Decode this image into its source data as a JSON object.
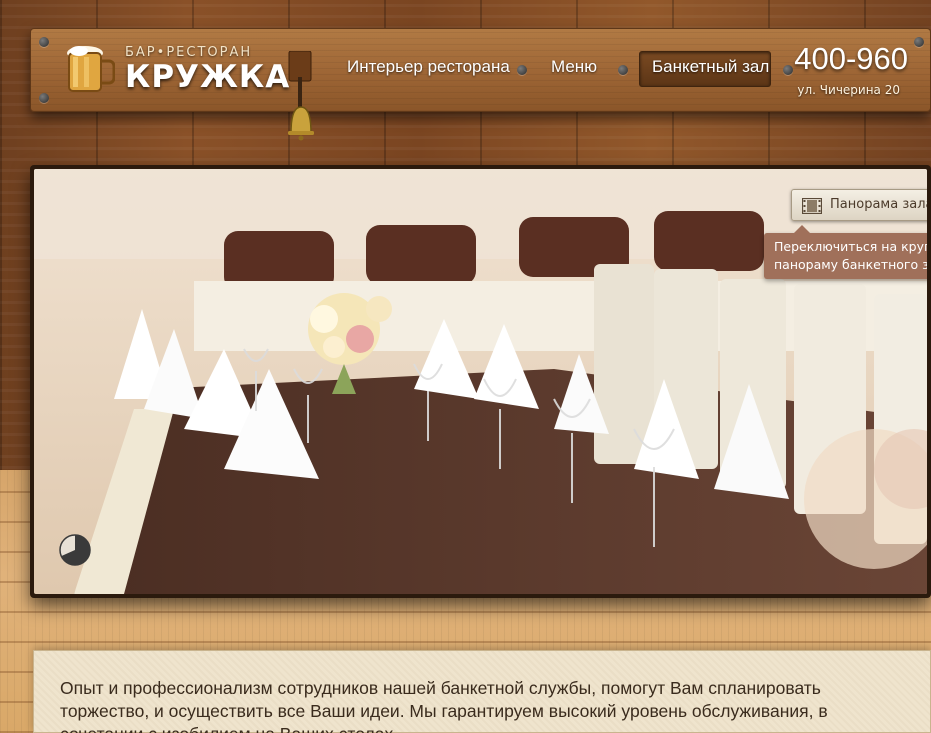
{
  "logo": {
    "top_text": "БАР•РЕСТОРАН",
    "name": "КРУЖКА"
  },
  "nav": {
    "items": [
      {
        "label": "Интерьер ресторана",
        "active": false
      },
      {
        "label": "Меню",
        "active": false
      },
      {
        "label": "Банкетный зал",
        "active": true
      }
    ]
  },
  "contact": {
    "phone": "400-960",
    "address": "ул. Чичерина 20"
  },
  "photo": {
    "panorama_button": "Панорама зала",
    "panorama_tooltip_line1": "Переключиться на кругов",
    "panorama_tooltip_line2": "панораму банкетного зал"
  },
  "intro": {
    "text": "Опыт и профессионализм сотрудников нашей банкетной службы, помогут Вам спланировать торжество, и осуществить все Ваши идеи. Мы гарантируем высокий уровень обслуживания, в сочетании с изобилием на Ваших столах."
  },
  "colors": {
    "header_wood": "#9d6535",
    "active_nav": "#5c3516",
    "tooltip": "#a0705a",
    "text_panel": "#efe4cd"
  },
  "icons": [
    "beer-mug-icon",
    "bell-icon",
    "pie-timer-icon",
    "film-icon"
  ]
}
